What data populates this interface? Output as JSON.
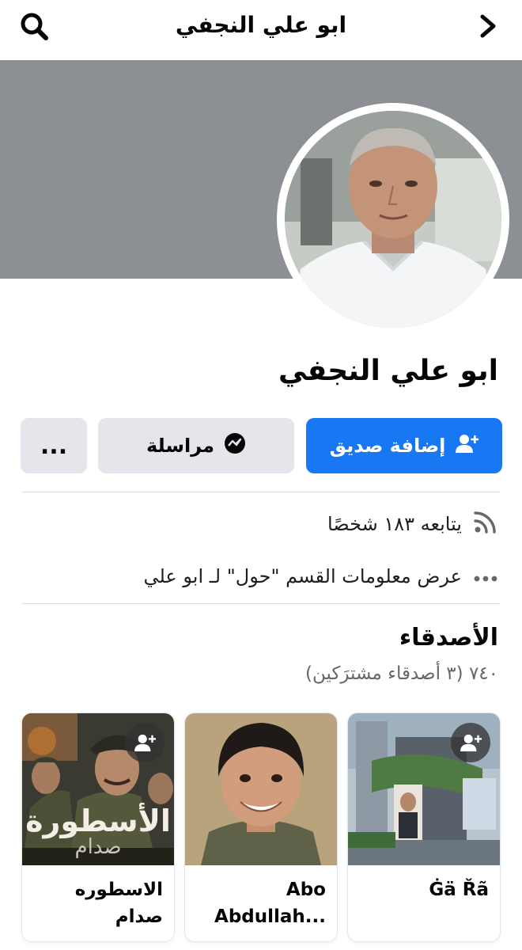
{
  "header": {
    "title": "ابو علي النجفي"
  },
  "profile": {
    "name": "ابو علي النجفي"
  },
  "actions": {
    "add_friend_label": "إضافة صديق",
    "message_label": "مراسلة",
    "more_label": "..."
  },
  "info": {
    "followers_text": "يتابعه ١٨٣ شخصًا",
    "about_text": "عرض معلومات القسم \"حول\" لـ ابو علي"
  },
  "friends": {
    "title": "الأصدقاء",
    "count_text": "٧٤٠ (٣ أصدقاء مشترَكين)",
    "items": [
      {
        "name": "Ġä Řã"
      },
      {
        "name": "Abo Abdullah..."
      },
      {
        "name": "الاسطوره صدام"
      }
    ]
  },
  "poster_text": {
    "title": "الأسطورة",
    "subtitle": "صدام"
  },
  "colors": {
    "accent": "#1877f2",
    "cover": "#8c8f93",
    "button_gray": "#e4e6eb"
  },
  "icons": [
    "search-icon",
    "chevron-right-icon",
    "add-friend-icon",
    "messenger-icon",
    "rss-icon",
    "dots-icon"
  ]
}
